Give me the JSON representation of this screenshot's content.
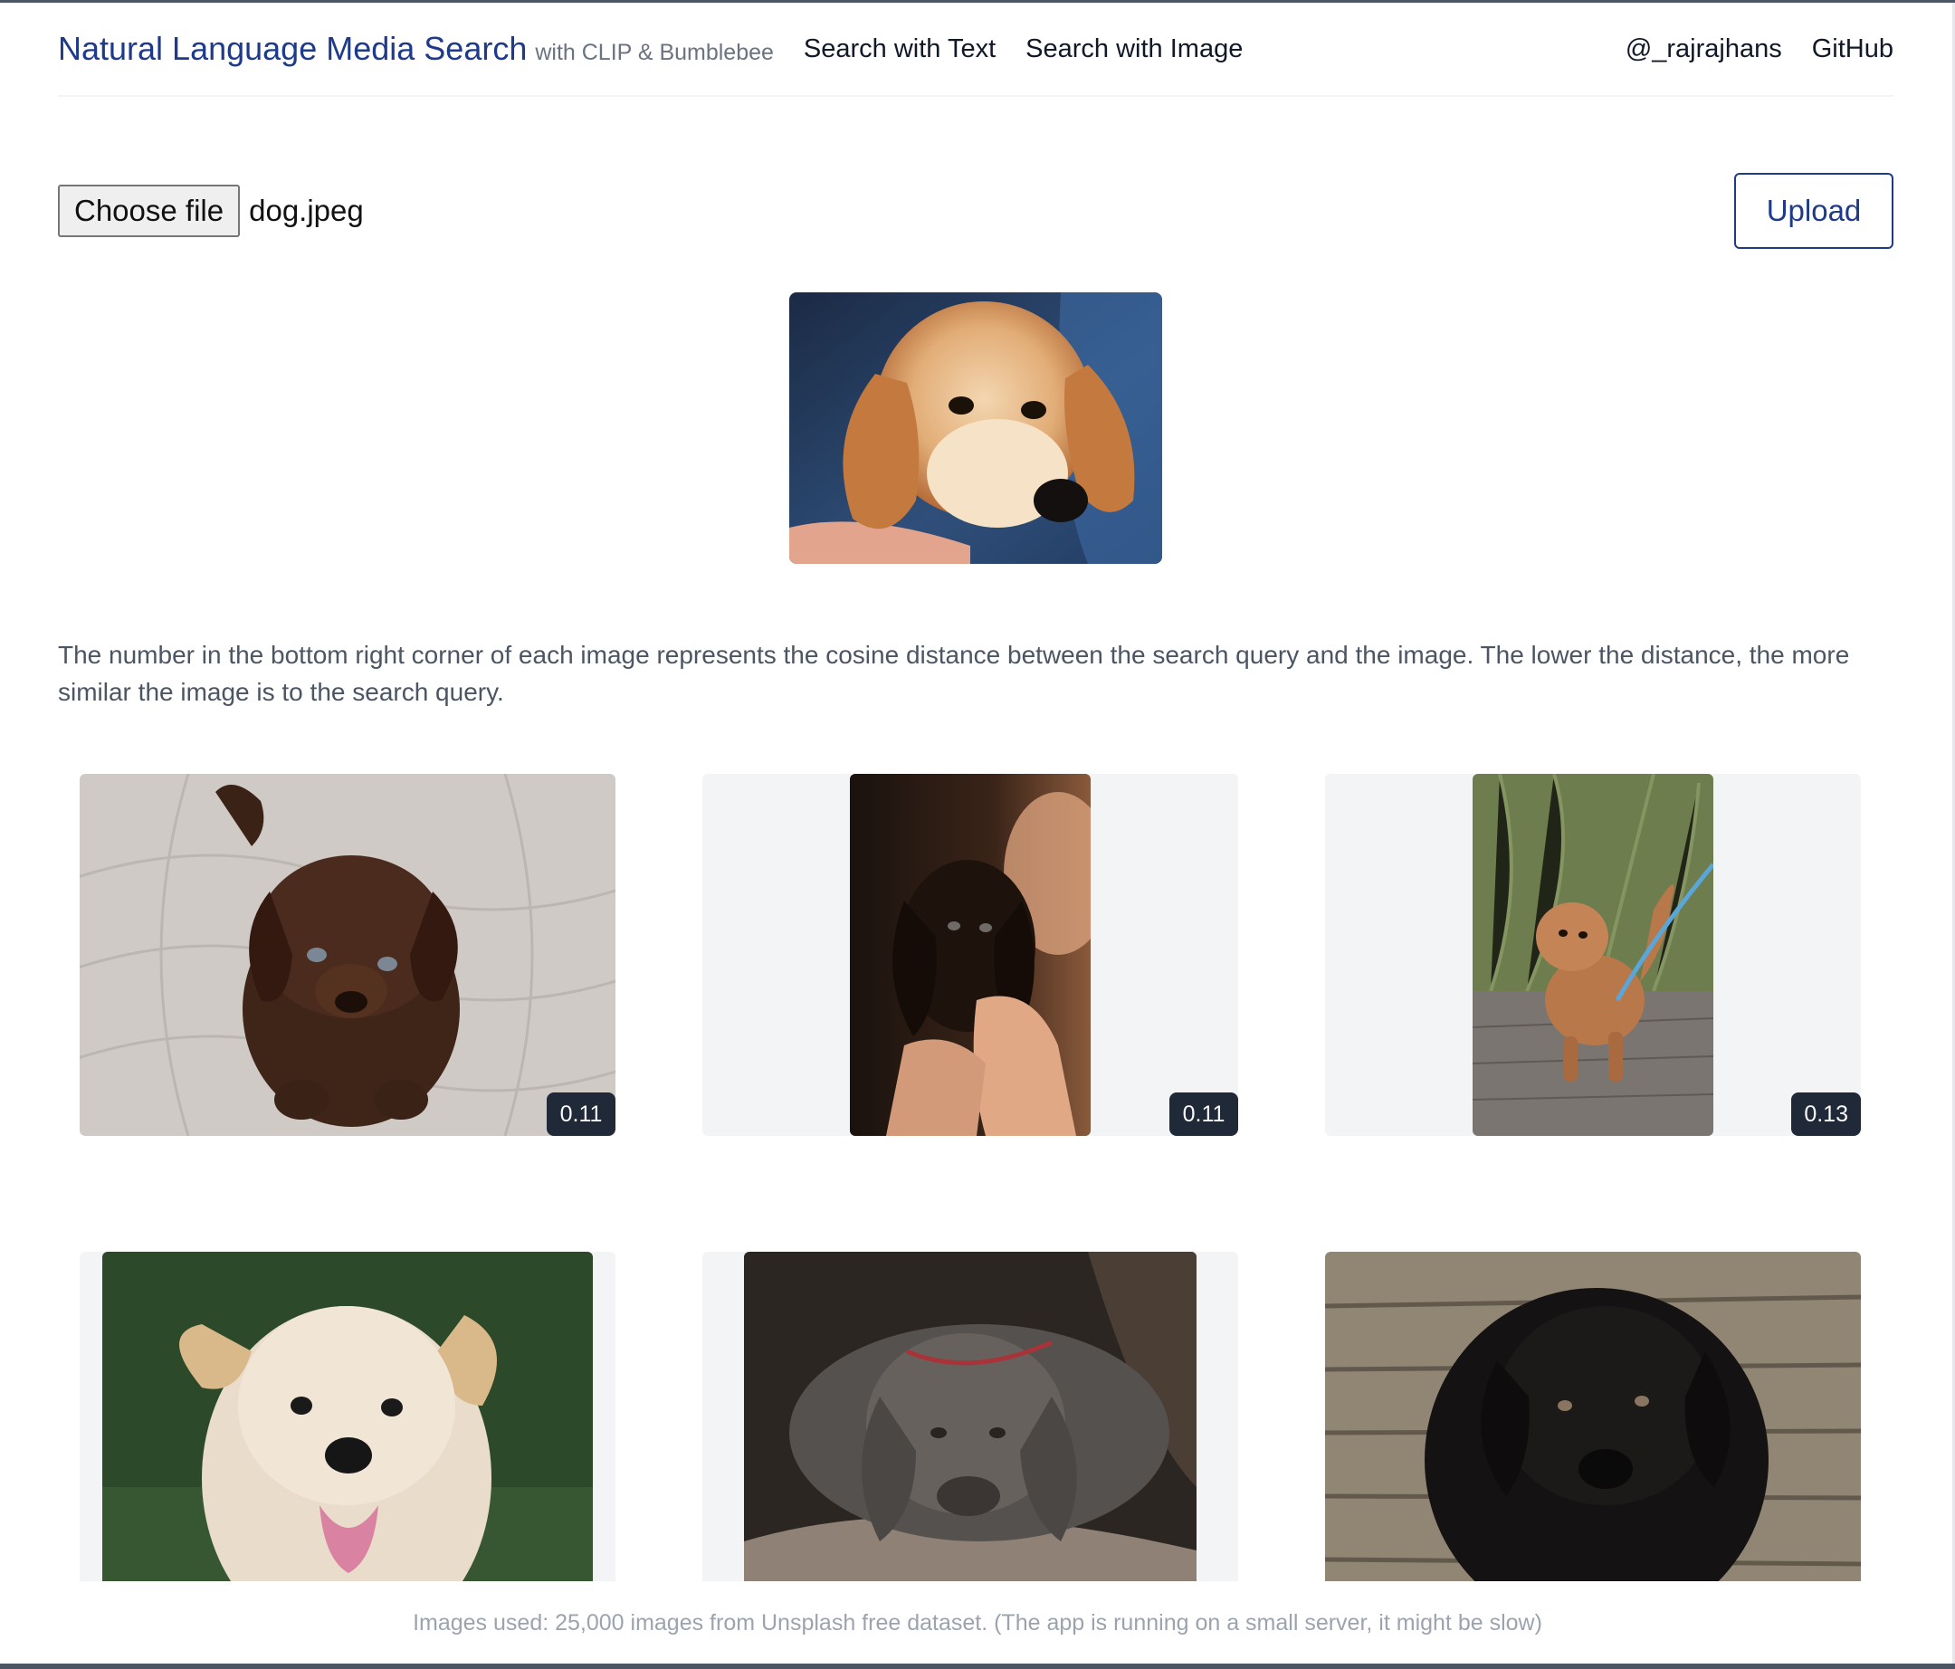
{
  "header": {
    "title": "Natural Language Media Search",
    "subtitle": "with CLIP & Bumblebee",
    "nav": [
      "Search with Text",
      "Search with Image"
    ],
    "right_nav": [
      "@_rajrajhans",
      "GitHub"
    ]
  },
  "upload": {
    "choose_label": "Choose file",
    "file_name": "dog.jpeg",
    "upload_label": "Upload"
  },
  "description": "The number in the bottom right corner of each image represents the cosine distance between the search query and the image. The lower the distance, the more similar the image is to the search query.",
  "results": [
    {
      "distance": "0.11"
    },
    {
      "distance": "0.11"
    },
    {
      "distance": "0.13"
    }
  ],
  "footer": "Images used: 25,000 images from Unsplash free dataset. (The app is running on a small server, it might be slow)",
  "colors": {
    "brand": "#1e3a8a",
    "badge_bg": "#1f2937",
    "card_bg": "#f3f4f6",
    "text_muted": "#4b5563"
  }
}
